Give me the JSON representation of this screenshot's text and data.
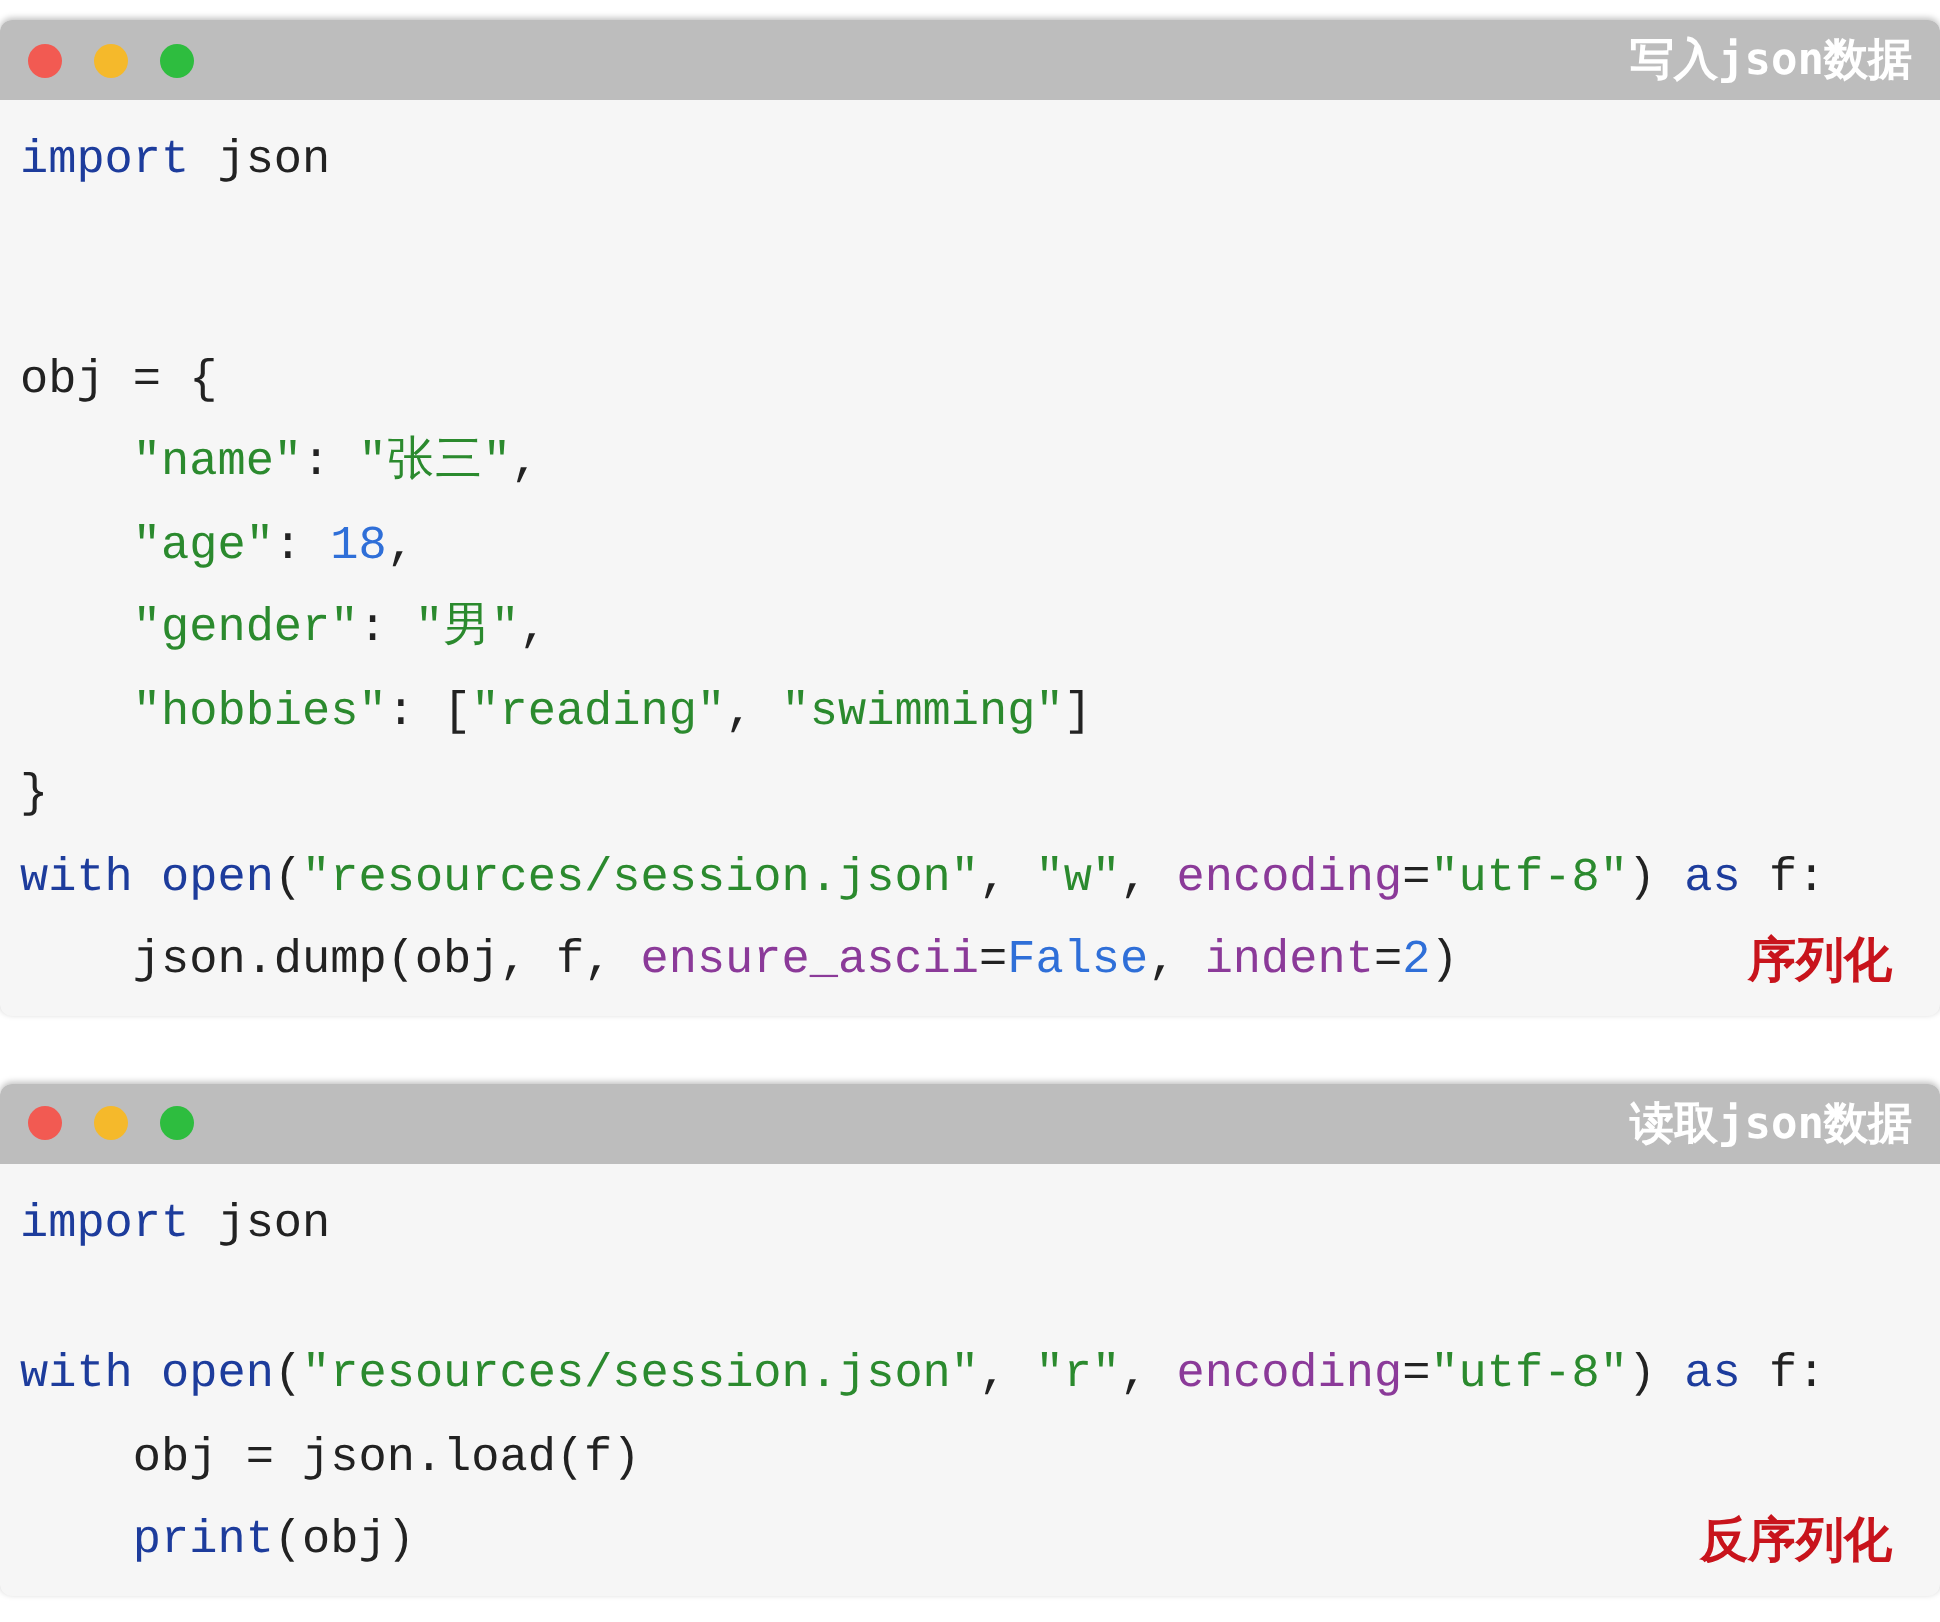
{
  "windows": [
    {
      "title": "写入json数据",
      "caption": "序列化",
      "lines": [
        {
          "kind": "code",
          "tokens": [
            {
              "kind": "keyword",
              "text": "import"
            },
            {
              "kind": "plain",
              "text": " json"
            }
          ]
        },
        {
          "kind": "blank"
        },
        {
          "kind": "blank"
        },
        {
          "kind": "code",
          "tokens": [
            {
              "kind": "plain",
              "text": "obj = {"
            }
          ]
        },
        {
          "kind": "code",
          "indented": true,
          "tokens": [
            {
              "kind": "string",
              "text": "\"name\""
            },
            {
              "kind": "plain",
              "text": ": "
            },
            {
              "kind": "string",
              "text": "\"张三\""
            },
            {
              "kind": "plain",
              "text": ","
            }
          ]
        },
        {
          "kind": "code",
          "indented": true,
          "tokens": [
            {
              "kind": "string",
              "text": "\"age\""
            },
            {
              "kind": "plain",
              "text": ": "
            },
            {
              "kind": "number",
              "text": "18"
            },
            {
              "kind": "plain",
              "text": ","
            }
          ]
        },
        {
          "kind": "code",
          "indented": true,
          "tokens": [
            {
              "kind": "string",
              "text": "\"gender\""
            },
            {
              "kind": "plain",
              "text": ": "
            },
            {
              "kind": "string",
              "text": "\"男\""
            },
            {
              "kind": "plain",
              "text": ","
            }
          ]
        },
        {
          "kind": "code",
          "indented": true,
          "tokens": [
            {
              "kind": "string",
              "text": "\"hobbies\""
            },
            {
              "kind": "plain",
              "text": ": ["
            },
            {
              "kind": "string",
              "text": "\"reading\""
            },
            {
              "kind": "plain",
              "text": ", "
            },
            {
              "kind": "string",
              "text": "\"swimming\""
            },
            {
              "kind": "plain",
              "text": "]"
            }
          ]
        },
        {
          "kind": "code",
          "tokens": [
            {
              "kind": "plain",
              "text": "}"
            }
          ]
        },
        {
          "kind": "code",
          "tokens": [
            {
              "kind": "keyword",
              "text": "with"
            },
            {
              "kind": "builtin",
              "text": "open",
              "space_before": true
            },
            {
              "kind": "plain",
              "text": "("
            },
            {
              "kind": "string",
              "text": "\"resources/session.json\""
            },
            {
              "kind": "plain",
              "text": ", "
            },
            {
              "kind": "string",
              "text": "\"w\""
            },
            {
              "kind": "plain",
              "text": ", "
            },
            {
              "kind": "param",
              "text": "encoding"
            },
            {
              "kind": "plain",
              "text": "="
            },
            {
              "kind": "string",
              "text": "\"utf-8\""
            },
            {
              "kind": "plain",
              "text": ") "
            },
            {
              "kind": "keyword",
              "text": "as"
            },
            {
              "kind": "plain",
              "text": " f:"
            }
          ]
        },
        {
          "kind": "code",
          "indented": true,
          "tokens": [
            {
              "kind": "plain",
              "text": "json.dump(obj, f, "
            },
            {
              "kind": "param",
              "text": "ensure_ascii"
            },
            {
              "kind": "plain",
              "text": "="
            },
            {
              "kind": "number",
              "text": "False"
            },
            {
              "kind": "plain",
              "text": ", "
            },
            {
              "kind": "param",
              "text": "indent"
            },
            {
              "kind": "plain",
              "text": "="
            },
            {
              "kind": "number",
              "text": "2"
            },
            {
              "kind": "plain",
              "text": ")"
            }
          ]
        }
      ]
    },
    {
      "title": "读取json数据",
      "caption": "反序列化",
      "lines": [
        {
          "kind": "code",
          "tokens": [
            {
              "kind": "keyword",
              "text": "import"
            },
            {
              "kind": "plain",
              "text": " json"
            }
          ]
        },
        {
          "kind": "blank"
        },
        {
          "kind": "code",
          "tokens": [
            {
              "kind": "keyword",
              "text": "with"
            },
            {
              "kind": "builtin",
              "text": "open",
              "space_before": true
            },
            {
              "kind": "plain",
              "text": "("
            },
            {
              "kind": "string",
              "text": "\"resources/session.json\""
            },
            {
              "kind": "plain",
              "text": ", "
            },
            {
              "kind": "string",
              "text": "\"r\""
            },
            {
              "kind": "plain",
              "text": ", "
            },
            {
              "kind": "param",
              "text": "encoding"
            },
            {
              "kind": "plain",
              "text": "="
            },
            {
              "kind": "string",
              "text": "\"utf-8\""
            },
            {
              "kind": "plain",
              "text": ") "
            },
            {
              "kind": "keyword",
              "text": "as"
            },
            {
              "kind": "plain",
              "text": " f:"
            }
          ]
        },
        {
          "kind": "code",
          "indented": true,
          "tokens": [
            {
              "kind": "plain",
              "text": "obj = json.load(f)"
            }
          ]
        },
        {
          "kind": "code",
          "indented": true,
          "tokens": [
            {
              "kind": "builtin",
              "text": "print"
            },
            {
              "kind": "plain",
              "text": "(obj)"
            }
          ]
        }
      ]
    }
  ]
}
